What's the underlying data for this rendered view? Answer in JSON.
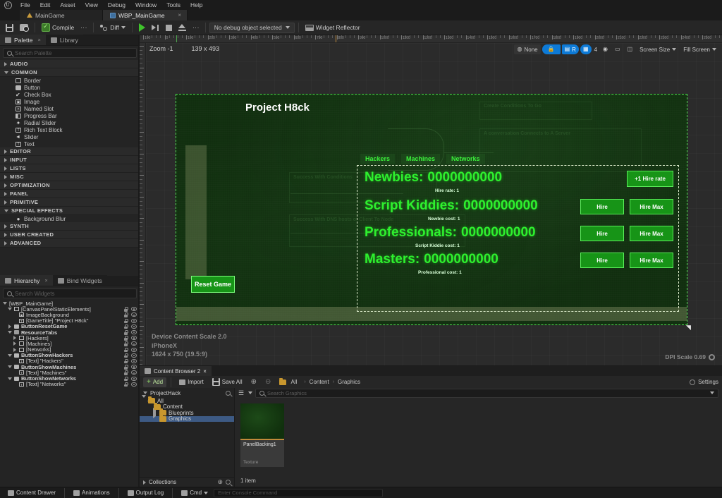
{
  "menu": {
    "items": [
      "File",
      "Edit",
      "Asset",
      "View",
      "Debug",
      "Window",
      "Tools",
      "Help"
    ],
    "logo_glyph": "U"
  },
  "asset_tabs": [
    {
      "label": "MainGame",
      "icon": "blueprint-icon",
      "active": false,
      "closable": false
    },
    {
      "label": "WBP_MainGame",
      "icon": "widget-blueprint-icon",
      "active": true,
      "closable": true,
      "close_glyph": "×"
    }
  ],
  "toolbar": {
    "save_label": "",
    "browse_label": "",
    "compile_label": "Compile",
    "diff_label": "Diff",
    "debug_object_label": "No debug object selected",
    "widget_reflector_label": "Widget Reflector",
    "dots_glyph": "⋮"
  },
  "palette": {
    "tabs": [
      {
        "label": "Palette",
        "active": true,
        "close_glyph": "×"
      },
      {
        "label": "Library",
        "active": false
      }
    ],
    "search_placeholder": "Search Palette",
    "search_value": "",
    "categories": [
      {
        "label": "AUDIO",
        "expanded": false,
        "items": []
      },
      {
        "label": "COMMON",
        "expanded": true,
        "items": [
          {
            "label": "Border",
            "icon": "border-icon"
          },
          {
            "label": "Button",
            "icon": "button-icon"
          },
          {
            "label": "Check Box",
            "icon": "checkbox-icon"
          },
          {
            "label": "Image",
            "icon": "image-icon"
          },
          {
            "label": "Named Slot",
            "icon": "named-slot-icon"
          },
          {
            "label": "Progress Bar",
            "icon": "progress-bar-icon"
          },
          {
            "label": "Radial Slider",
            "icon": "radial-slider-icon"
          },
          {
            "label": "Rich Text Block",
            "icon": "rich-text-icon"
          },
          {
            "label": "Slider",
            "icon": "slider-icon"
          },
          {
            "label": "Text",
            "icon": "text-icon"
          }
        ]
      },
      {
        "label": "EDITOR",
        "expanded": false,
        "items": []
      },
      {
        "label": "INPUT",
        "expanded": false,
        "items": []
      },
      {
        "label": "LISTS",
        "expanded": false,
        "items": []
      },
      {
        "label": "MISC",
        "expanded": false,
        "items": []
      },
      {
        "label": "OPTIMIZATION",
        "expanded": false,
        "items": []
      },
      {
        "label": "PANEL",
        "expanded": false,
        "items": []
      },
      {
        "label": "PRIMITIVE",
        "expanded": false,
        "items": []
      },
      {
        "label": "SPECIAL EFFECTS",
        "expanded": true,
        "items": [
          {
            "label": "Background Blur",
            "icon": "background-blur-icon"
          }
        ]
      },
      {
        "label": "SYNTH",
        "expanded": false,
        "items": []
      },
      {
        "label": "USER CREATED",
        "expanded": false,
        "items": []
      },
      {
        "label": "ADVANCED",
        "expanded": false,
        "items": []
      }
    ]
  },
  "hierarchy": {
    "tabs": [
      {
        "label": "Hierarchy",
        "active": true,
        "close_glyph": "×"
      },
      {
        "label": "Bind Widgets",
        "active": false
      }
    ],
    "search_placeholder": "Search Widgets",
    "search_value": "",
    "nodes": [
      {
        "label": "[WBP_MainGame]",
        "indent": 0,
        "icon": "none",
        "twist": "down",
        "bold": false,
        "actions": false
      },
      {
        "label": "[CanvasPanelStaticElements]",
        "indent": 1,
        "icon": "canvas",
        "twist": "down",
        "bold": false,
        "actions": true
      },
      {
        "label": "ImageBackground",
        "indent": 2,
        "icon": "img",
        "twist": "none",
        "bold": false,
        "actions": true,
        "locked": true
      },
      {
        "label": "[GameTitle] \"Project H8ck\"",
        "indent": 2,
        "icon": "txt",
        "twist": "none",
        "bold": false,
        "actions": true
      },
      {
        "label": "ButtonResetGame",
        "indent": 1,
        "icon": "btn",
        "twist": "right",
        "bold": true,
        "actions": true
      },
      {
        "label": "ResourceTabs",
        "indent": 1,
        "icon": "vbox",
        "twist": "down",
        "bold": true,
        "actions": true
      },
      {
        "label": "[Hackers]",
        "indent": 2,
        "icon": "canvas",
        "twist": "right",
        "bold": false,
        "actions": true
      },
      {
        "label": "[Machines]",
        "indent": 2,
        "icon": "canvas",
        "twist": "right",
        "bold": false,
        "actions": true
      },
      {
        "label": "[Networks]",
        "indent": 2,
        "icon": "canvas",
        "twist": "right",
        "bold": false,
        "actions": true
      },
      {
        "label": "ButtonShowHackers",
        "indent": 1,
        "icon": "btn",
        "twist": "down",
        "bold": true,
        "actions": true
      },
      {
        "label": "[Text] \"Hackers\"",
        "indent": 2,
        "icon": "txt",
        "twist": "none",
        "bold": false,
        "actions": true
      },
      {
        "label": "ButtonShowMachines",
        "indent": 1,
        "icon": "btn",
        "twist": "down",
        "bold": true,
        "actions": true
      },
      {
        "label": "[Text] \"Machines\"",
        "indent": 2,
        "icon": "txt",
        "twist": "none",
        "bold": false,
        "actions": true
      },
      {
        "label": "ButtonShowNetworks",
        "indent": 1,
        "icon": "btn",
        "twist": "down",
        "bold": true,
        "actions": true
      },
      {
        "label": "[Text] \"Networks\"",
        "indent": 2,
        "icon": "txt",
        "twist": "none",
        "bold": false,
        "actions": true
      }
    ]
  },
  "viewport": {
    "zoom_label": "Zoom -1",
    "size_label": "139 x 493",
    "controls": [
      {
        "name": "none-selector",
        "label": "None",
        "icon": "globe-icon",
        "on": false
      },
      {
        "name": "lock-toggle",
        "label": "",
        "icon": "lock-icon",
        "on": true
      },
      {
        "name": "layout-toggle",
        "label": "R",
        "icon": "layout-icon",
        "on": true
      },
      {
        "name": "grid-toggle",
        "label": "4",
        "icon": "grid-icon",
        "on": true
      },
      {
        "name": "snap-toggle",
        "label": "",
        "icon": "target-icon",
        "on": false
      },
      {
        "name": "screenshot-button",
        "label": "",
        "icon": "camera-icon",
        "on": false
      },
      {
        "name": "mirror-toggle",
        "label": "",
        "icon": "mirror-icon",
        "on": false
      },
      {
        "name": "screen-size-dropdown",
        "label": "Screen Size",
        "icon": "chevron-down-icon",
        "on": false
      },
      {
        "name": "fill-screen-dropdown",
        "label": "Fill Screen",
        "icon": "chevron-down-icon",
        "on": false
      }
    ],
    "device_info_lines": [
      "Device Content Scale 2.0",
      "iPhoneX",
      "1624 x 750 (19.5:9)"
    ],
    "dpi_label": "DPI Scale 0.69",
    "ruler_labels": [
      "100",
      "0",
      "100",
      "200",
      "300",
      "400",
      "500",
      "600",
      "700",
      "800",
      "900",
      "1000",
      "1100",
      "1200",
      "1300",
      "1400",
      "1500",
      "1600",
      "1700",
      "1800",
      "1900",
      "2000",
      "2100",
      "2200",
      "2300",
      "2400",
      "2500"
    ]
  },
  "game": {
    "title": "Project H8ck",
    "tabs": [
      {
        "label": "Hackers"
      },
      {
        "label": "Machines"
      },
      {
        "label": "Networks"
      }
    ],
    "rows": [
      {
        "name": "Newbies:",
        "value": "0000000000",
        "sub": "Hire rate: 1",
        "buttons": [
          {
            "label": "+1 Hire rate",
            "kind": "wide"
          }
        ]
      },
      {
        "name": "Script Kiddies:",
        "value": "0000000000",
        "sub": "Newbie cost: 1",
        "buttons": [
          {
            "label": "Hire",
            "kind": "normal"
          },
          {
            "label": "Hire Max",
            "kind": "normal"
          }
        ]
      },
      {
        "name": "Professionals:",
        "value": "0000000000",
        "sub": "Script Kiddie cost: 1",
        "buttons": [
          {
            "label": "Hire",
            "kind": "normal"
          },
          {
            "label": "Hire Max",
            "kind": "normal"
          }
        ]
      },
      {
        "name": "Masters:",
        "value": "0000000000",
        "sub": "Professional cost: 1",
        "buttons": [
          {
            "label": "Hire",
            "kind": "normal"
          },
          {
            "label": "Hire Max",
            "kind": "normal"
          }
        ]
      }
    ],
    "reset_label": "Reset Game",
    "accent_green": "#2ef02e",
    "button_green": "#179417",
    "panel_bg": "#123010",
    "ghost_texts": [
      "Create Conditions To Go",
      "A conversation Connects to A Server",
      "Success With Conditions",
      "Success With DNS hosts of Client To Node"
    ]
  },
  "content_browser": {
    "tab_label": "Content Browser 2",
    "tab_close_glyph": "×",
    "add_label": "Add",
    "import_label": "Import",
    "save_all_label": "Save All",
    "breadcrumbs": [
      "All",
      "Content",
      "Graphics"
    ],
    "breadcrumb_sep": "›",
    "source_label": "ProjectHack",
    "search_placeholder": "Search Graphics",
    "search_value": "",
    "tree": [
      {
        "label": "All",
        "indent": 0,
        "twist": "down",
        "selected": false
      },
      {
        "label": "Content",
        "indent": 1,
        "twist": "down",
        "selected": false
      },
      {
        "label": "Blueprints",
        "indent": 2,
        "twist": "right",
        "selected": false
      },
      {
        "label": "Graphics",
        "indent": 2,
        "twist": "none",
        "selected": true
      }
    ],
    "collections_label": "Collections",
    "assets": [
      {
        "name": "PanelBacking1",
        "type": "Texture"
      }
    ],
    "item_count_label": "1 item",
    "settings_label": "Settings"
  },
  "status_bar": {
    "content_drawer_label": "Content Drawer",
    "animations_label": "Animations",
    "output_log_label": "Output Log",
    "cmd_label": "Cmd",
    "console_placeholder": "Enter Console Command"
  }
}
